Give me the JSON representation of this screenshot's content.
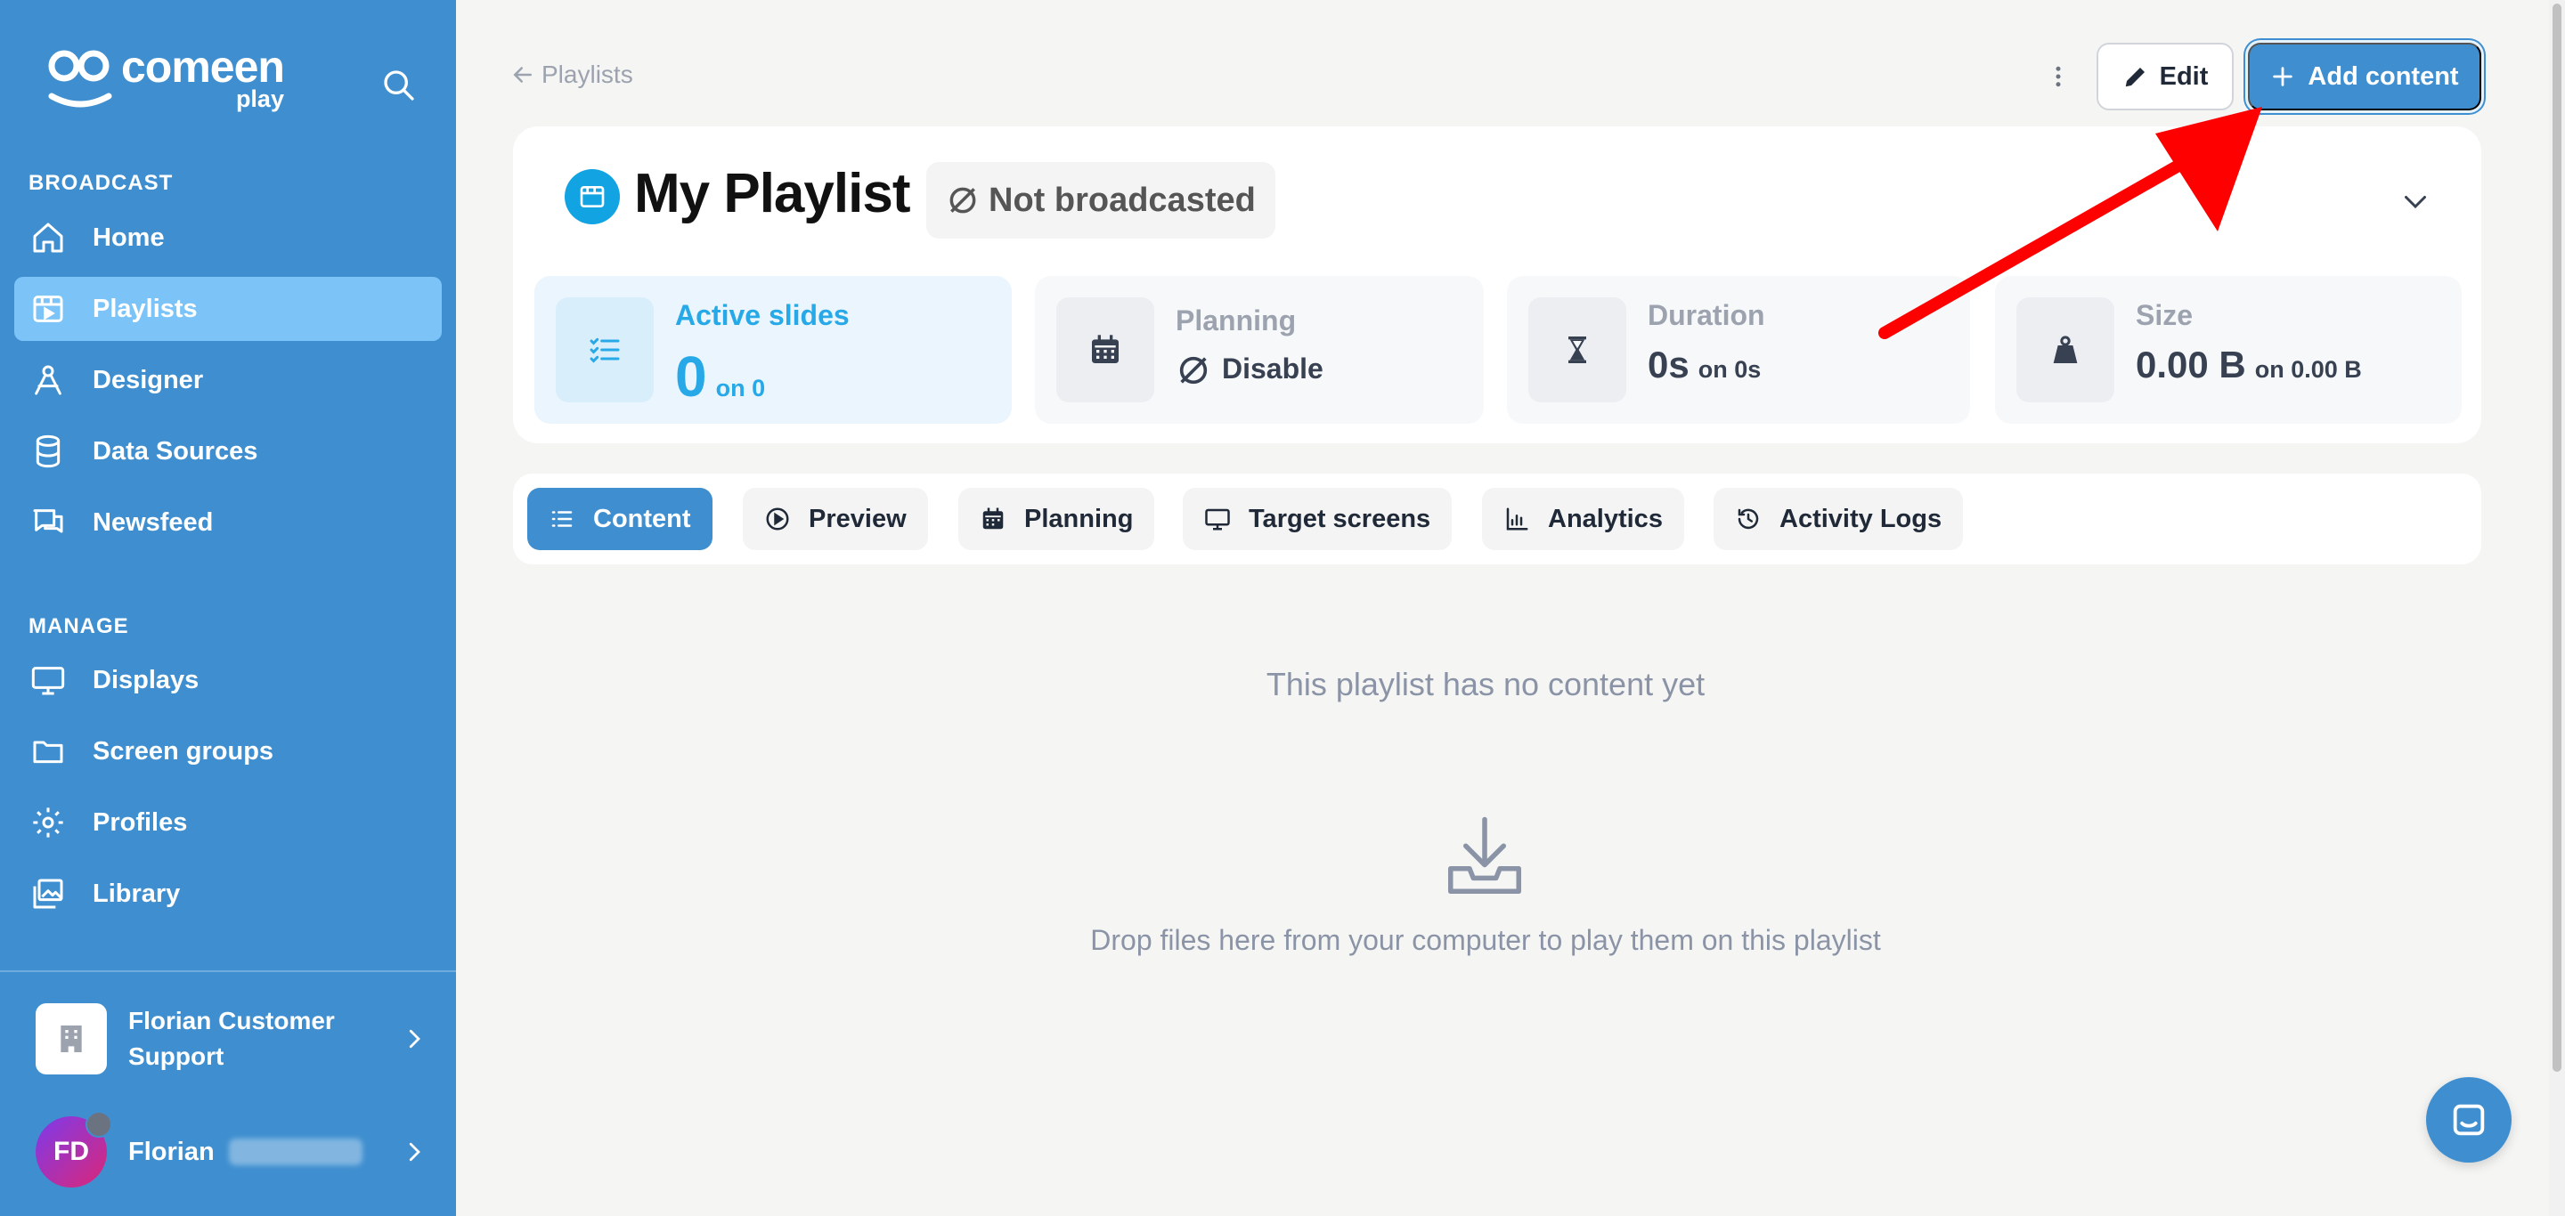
{
  "sidebar": {
    "logo_text": "comeen",
    "logo_sub": "play",
    "sections": [
      {
        "label": "BROADCAST",
        "items": [
          {
            "label": "Home",
            "icon": "home-icon"
          },
          {
            "label": "Playlists",
            "icon": "playlist-icon",
            "active": true
          },
          {
            "label": "Designer",
            "icon": "designer-icon"
          },
          {
            "label": "Data Sources",
            "icon": "database-icon"
          },
          {
            "label": "Newsfeed",
            "icon": "newsfeed-icon"
          }
        ]
      },
      {
        "label": "MANAGE",
        "items": [
          {
            "label": "Displays",
            "icon": "monitor-icon"
          },
          {
            "label": "Screen groups",
            "icon": "folder-icon"
          },
          {
            "label": "Profiles",
            "icon": "gear-icon"
          },
          {
            "label": "Library",
            "icon": "images-icon"
          }
        ]
      }
    ],
    "organization": "Florian Customer Support",
    "user_initials": "FD",
    "user_name": "Florian"
  },
  "topbar": {
    "back_label": "Playlists",
    "edit_label": "Edit",
    "add_label": "Add content"
  },
  "playlist": {
    "title": "My Playlist",
    "status": "Not broadcasted"
  },
  "stats": {
    "active_slides": {
      "label": "Active slides",
      "value": "0",
      "total": "on 0"
    },
    "planning": {
      "label": "Planning",
      "value": "Disable"
    },
    "duration": {
      "label": "Duration",
      "value": "0s",
      "total": "on 0s"
    },
    "size": {
      "label": "Size",
      "value": "0.00 B",
      "total": "on 0.00 B"
    }
  },
  "tabs": [
    {
      "label": "Content",
      "icon": "list-icon",
      "active": true
    },
    {
      "label": "Preview",
      "icon": "play-icon"
    },
    {
      "label": "Planning",
      "icon": "calendar-icon"
    },
    {
      "label": "Target screens",
      "icon": "monitor-icon"
    },
    {
      "label": "Analytics",
      "icon": "chart-icon"
    },
    {
      "label": "Activity Logs",
      "icon": "history-icon"
    }
  ],
  "empty_state": {
    "title": "This playlist has no content yet",
    "drop_text": "Drop files here from your computer to play them on this playlist"
  },
  "colors": {
    "sidebar": "#3f8fd0",
    "active_nav": "#7cc4f8",
    "accent": "#27a9e8",
    "annotation_arrow": "#ff0000"
  }
}
